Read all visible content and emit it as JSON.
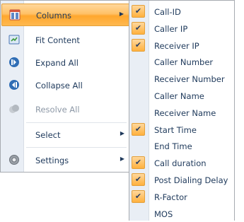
{
  "main_menu": {
    "items": [
      {
        "label": "Columns",
        "icon": "columns-icon",
        "highlighted": true,
        "submenu": true
      },
      {
        "label": "Fit Content",
        "icon": "fit-content-icon"
      },
      {
        "label": "Expand All",
        "icon": "expand-all-icon"
      },
      {
        "label": "Collapse All",
        "icon": "collapse-all-icon"
      },
      {
        "label": "Resolve All",
        "icon": "resolve-all-icon",
        "disabled": true
      },
      {
        "label": "Select",
        "submenu": true
      },
      {
        "label": "Settings",
        "icon": "gear-icon",
        "submenu": true
      }
    ]
  },
  "columns_submenu": {
    "items": [
      {
        "label": "Call-ID",
        "checked": true
      },
      {
        "label": "Caller IP",
        "checked": true
      },
      {
        "label": "Receiver IP",
        "checked": true
      },
      {
        "label": "Caller Number",
        "checked": false
      },
      {
        "label": "Receiver Number",
        "checked": false
      },
      {
        "label": "Caller Name",
        "checked": false
      },
      {
        "label": "Receiver Name",
        "checked": false
      },
      {
        "label": "Start Time",
        "checked": true
      },
      {
        "label": "End Time",
        "checked": false
      },
      {
        "label": "Call duration",
        "checked": true
      },
      {
        "label": "Post Dialing Delay",
        "checked": true
      },
      {
        "label": "R-Factor",
        "checked": true
      },
      {
        "label": "MOS",
        "checked": false
      }
    ]
  },
  "colors": {
    "highlight": "#ffc167",
    "text": "#1e395b",
    "disabled_text": "#8d98a6",
    "gutter": "#e9eef5"
  }
}
